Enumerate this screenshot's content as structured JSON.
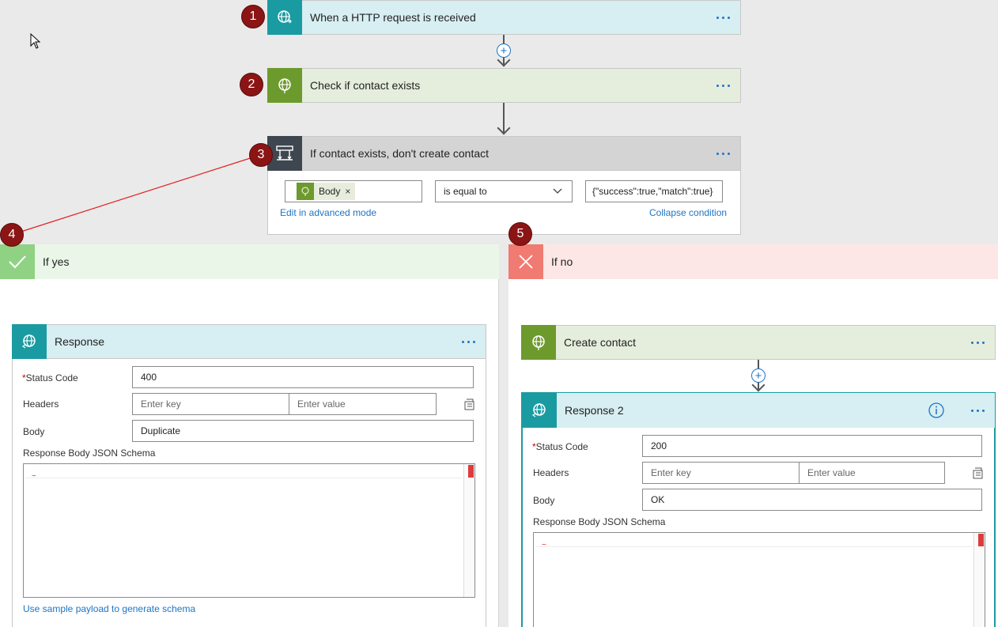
{
  "steps": {
    "trigger": {
      "title": "When a HTTP request is received",
      "badge": "1",
      "icon": "http-globe-icon"
    },
    "check": {
      "title": "Check if contact exists",
      "badge": "2",
      "icon": "http-globe-icon"
    },
    "condition": {
      "title": "If contact exists, don't create contact",
      "badge": "3",
      "icon": "condition-icon",
      "token_label": "Body",
      "operator": "is equal to",
      "value": "{\"success\":true,\"match\":true}",
      "edit_link": "Edit in advanced mode",
      "collapse_link": "Collapse condition"
    }
  },
  "branches": {
    "yes": {
      "title": "If yes",
      "badge": "4",
      "color": "#8fd283",
      "response": {
        "title": "Response",
        "status_label": "Status Code",
        "status_value": "400",
        "headers_label": "Headers",
        "key_placeholder": "Enter key",
        "value_placeholder": "Enter value",
        "body_label": "Body",
        "body_value": "Duplicate",
        "schema_label": "Response Body JSON Schema",
        "sample_link": "Use sample payload to generate schema"
      }
    },
    "no": {
      "title": "If no",
      "badge": "5",
      "color": "#f07b72",
      "create": {
        "title": "Create contact"
      },
      "response": {
        "title": "Response 2",
        "status_label": "Status Code",
        "status_value": "200",
        "headers_label": "Headers",
        "key_placeholder": "Enter key",
        "value_placeholder": "Enter value",
        "body_label": "Body",
        "body_value": "OK",
        "schema_label": "Response Body JSON Schema"
      }
    }
  },
  "colors": {
    "accent": "#1d74c6",
    "badge": "#8b1515",
    "teal": "#1a9ba1",
    "green": "#6d9a2c"
  }
}
